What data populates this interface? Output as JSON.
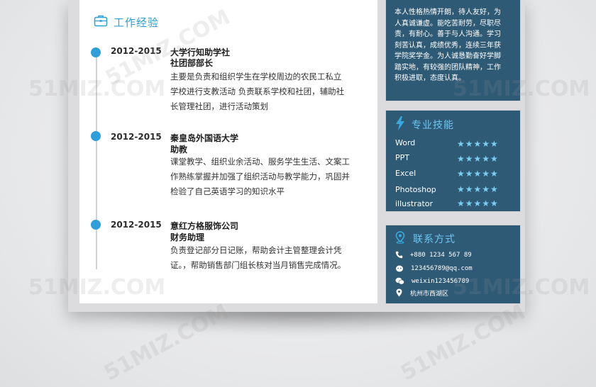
{
  "work": {
    "section_title": "工作经验",
    "entries": [
      {
        "date": "2012-2015",
        "org": "大学行知助学社",
        "role": "社团部部长",
        "lines": [
          "主要是负责和组织学生在学校周边的农民工私立",
          "学校进行支教活动 负责联系学校和社团，辅助社",
          "长管理社团，进行活动策划"
        ]
      },
      {
        "date": "2012-2015",
        "org": "秦皇岛外国语大学",
        "role": "助教",
        "lines": [
          "课堂教学、组织业余活动、服务学生生活、文案工",
          "作熟练掌握并加强了组织活动与教学能力，巩固并",
          "检验了自己英语学习的知识水平"
        ]
      },
      {
        "date": "2012-2015",
        "org": "意红方格服饰公司",
        "role": "财务助理",
        "lines": [
          "负责登记部分日记账，帮助会计主管整理会计凭",
          "证。，帮助销售部门组长核对当月销售完成情况。"
        ]
      }
    ]
  },
  "profile": {
    "lines": [
      "本人性格热情开朗，待人友好，为",
      "人真诚谦虚。能吃苦耐劳，尽职尽",
      "责，有耐心。善于与人沟通。学习",
      "刻苦认真，成绩优秀，连续三年获",
      "学院奖学金。为人诚恳勤奋好学脚",
      "踏实地，有较强的团队精神，工作",
      "积极进取，态度认真。"
    ]
  },
  "skills": {
    "title": "专业技能",
    "items": [
      {
        "name": "Word",
        "stars": "★★★★★",
        "rating": 5
      },
      {
        "name": "PPT",
        "stars": "★★★★★",
        "rating": 5
      },
      {
        "name": "Excel",
        "stars": "★★★★★",
        "rating": 5
      },
      {
        "name": "Photoshop",
        "stars": "★★★★★",
        "rating": 5
      },
      {
        "name": "illustrator",
        "stars": "★★★★★",
        "rating": 5
      }
    ]
  },
  "contact": {
    "title": "联系方式",
    "phone": "+880 1234 567 89",
    "email": "123456789@qq.com",
    "wechat": "weixin123456789",
    "address": "杭州市西湖区"
  },
  "watermark_text": "51MIZ.COM",
  "icons": {
    "work": "briefcase-icon",
    "skills": "lightning-icon",
    "contact": "location-pin-icon",
    "phone": "phone-icon",
    "email": "email-icon",
    "wechat": "wechat-icon",
    "address": "map-pin-icon"
  },
  "colors": {
    "accent_blue": "#2a9fd8",
    "sidebar_bg": "#2e5a76",
    "star_color": "#7ccdf2"
  }
}
